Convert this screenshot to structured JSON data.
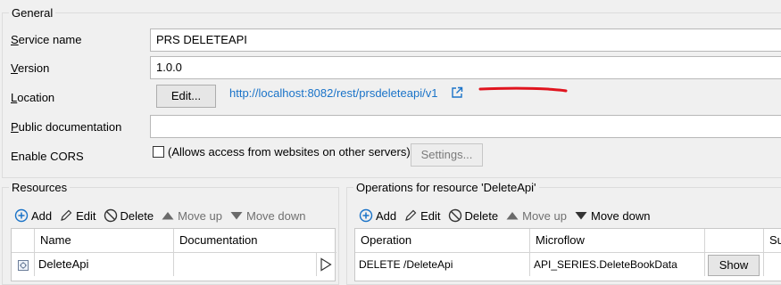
{
  "general": {
    "legend": "General",
    "service_name_label": "Service name",
    "service_name_value": "PRS DELETEAPI",
    "version_label": "Version",
    "version_value": "1.0.0",
    "location_label": "Location",
    "edit_button": "Edit...",
    "location_url": "http://localhost:8082/rest/prsdeleteapi/v1",
    "public_doc_label": "Public documentation",
    "public_doc_value": "",
    "enable_cors_label": "Enable CORS",
    "cors_checked": false,
    "cors_checkbox_text": "(Allows access from websites on other servers)",
    "settings_button": "Settings..."
  },
  "resources": {
    "legend": "Resources",
    "toolbar": {
      "add": "Add",
      "edit": "Edit",
      "delete": "Delete",
      "move_up": "Move up",
      "move_down": "Move down"
    },
    "columns": [
      "Name",
      "Documentation"
    ],
    "rows": [
      {
        "name": "DeleteApi",
        "documentation": ""
      }
    ]
  },
  "operations": {
    "legend": "Operations for resource 'DeleteApi'",
    "toolbar": {
      "add": "Add",
      "edit": "Edit",
      "delete": "Delete",
      "move_up": "Move up",
      "move_down": "Move down"
    },
    "columns": [
      "Operation",
      "Microflow",
      "",
      "Su"
    ],
    "rows": [
      {
        "operation": "DELETE /DeleteApi",
        "microflow": "API_SERIES.DeleteBookData",
        "show_button": "Show"
      }
    ]
  },
  "colors": {
    "link": "#1a73c8",
    "annotation": "#e0141e",
    "add_icon": "#1a73c8"
  }
}
